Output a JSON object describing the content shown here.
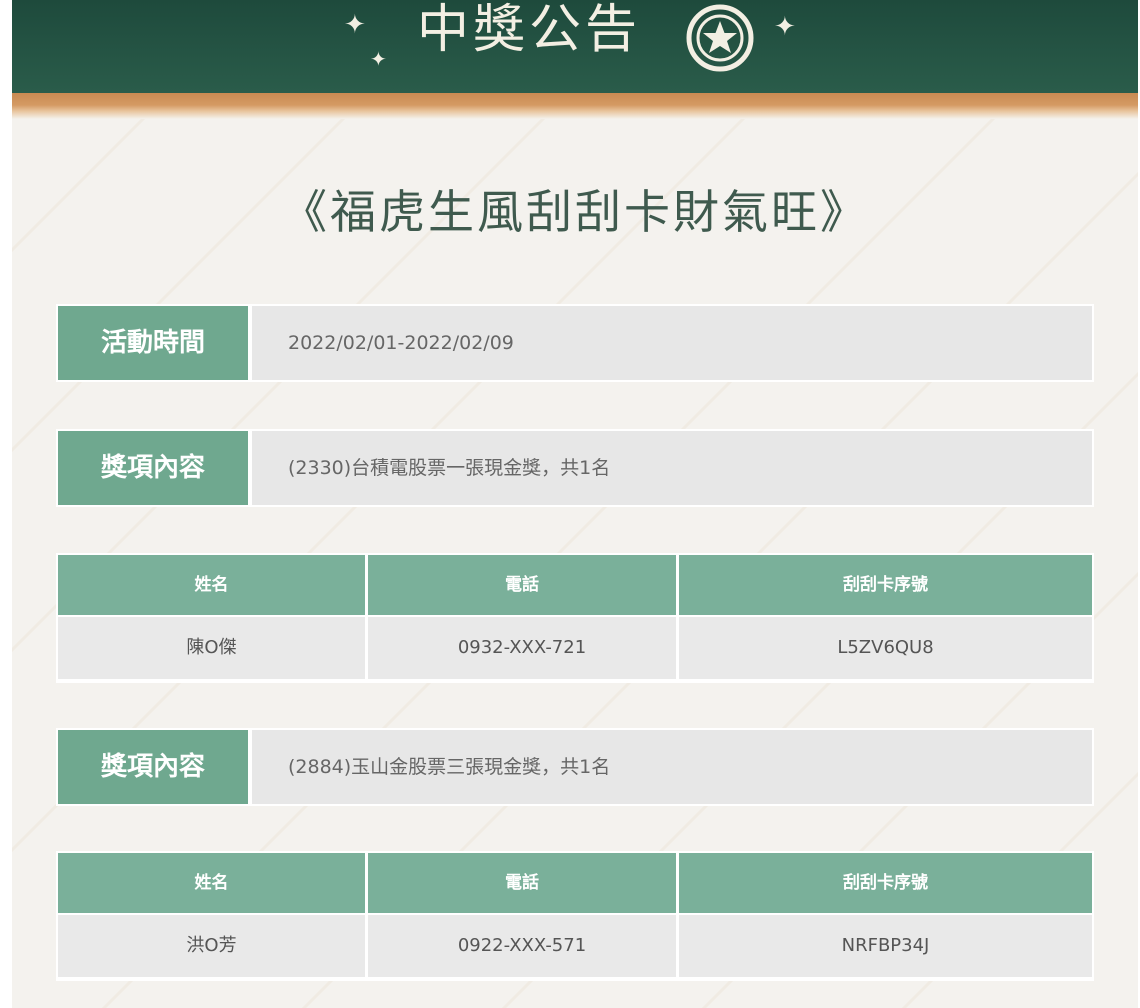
{
  "banner": {
    "title": "中獎公告",
    "icon": "star-badge-icon",
    "colors": {
      "background": "#24523f",
      "strip": "#d49a63",
      "text": "#f3efe3"
    }
  },
  "event_title": "《福虎生風刮刮卡財氣旺》",
  "event_period": {
    "label": "活動時間",
    "value": "2022/02/01-2022/02/09"
  },
  "prizes": [
    {
      "label": "獎項內容",
      "content": "(2330)台積電股票一張現金獎，共1名",
      "table": {
        "headers": [
          "姓名",
          "電話",
          "刮刮卡序號"
        ],
        "rows": [
          {
            "name": "陳O傑",
            "phone": "0932-XXX-721",
            "serial": "L5ZV6QU8"
          }
        ]
      }
    },
    {
      "label": "獎項內容",
      "content": "(2884)玉山金股票三張現金獎，共1名",
      "table": {
        "headers": [
          "姓名",
          "電話",
          "刮刮卡序號"
        ],
        "rows": [
          {
            "name": "洪O芳",
            "phone": "0922-XXX-571",
            "serial": "NRFBP34J"
          }
        ]
      }
    }
  ],
  "theme": {
    "label_green": "#6fa88f",
    "header_green": "#7ab09a",
    "title_color": "#3f5a4e"
  }
}
